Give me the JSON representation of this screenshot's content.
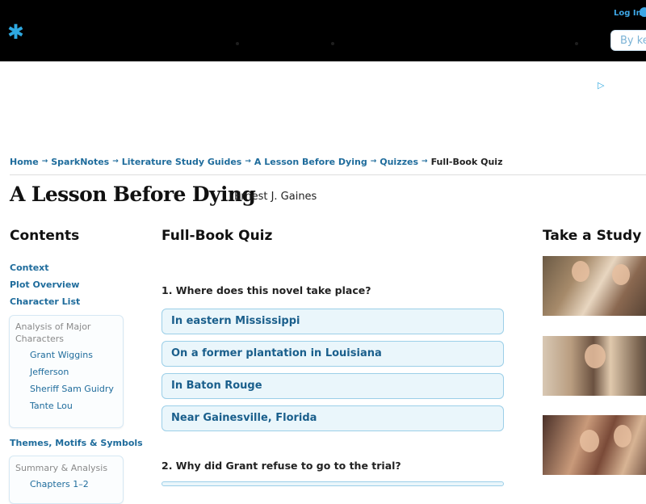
{
  "header": {
    "login_label": "Log In",
    "search_placeholder": "By ke"
  },
  "breadcrumb": {
    "items": [
      "Home",
      "SparkNotes",
      "Literature Study Guides",
      "A Lesson Before Dying",
      "Quizzes"
    ],
    "separator": "→",
    "current": "Full-Book Quiz"
  },
  "book": {
    "title": "A Lesson Before Dying",
    "author": "Ernest J. Gaines"
  },
  "sidebar": {
    "heading": "Contents",
    "links": [
      "Context",
      "Plot Overview",
      "Character List"
    ],
    "characters_box": {
      "heading": "Analysis of Major Characters",
      "items": [
        "Grant Wiggins",
        "Jefferson",
        "Sheriff Sam Guidry",
        "Tante Lou"
      ]
    },
    "themes_link": "Themes, Motifs & Symbols",
    "summary_box": {
      "heading": "Summary & Analysis",
      "items": [
        "Chapters 1–2"
      ]
    }
  },
  "quiz": {
    "heading": "Full-Book Quiz",
    "questions": [
      {
        "text": "1. Where does this novel take place?",
        "answers": [
          "In eastern Mississippi",
          "On a former plantation in Louisiana",
          "In Baton Rouge",
          "Near Gainesville, Florida"
        ]
      },
      {
        "text": "2. Why did Grant refuse to go to the trial?",
        "answers": []
      }
    ]
  },
  "study_break": {
    "heading": "Take a Study Br"
  },
  "colors": {
    "accent": "#2ea8e0",
    "link": "#1f6c9c",
    "answer_bg": "#eaf6fb",
    "answer_border": "#9ccfe8",
    "topbar": "#000000"
  }
}
